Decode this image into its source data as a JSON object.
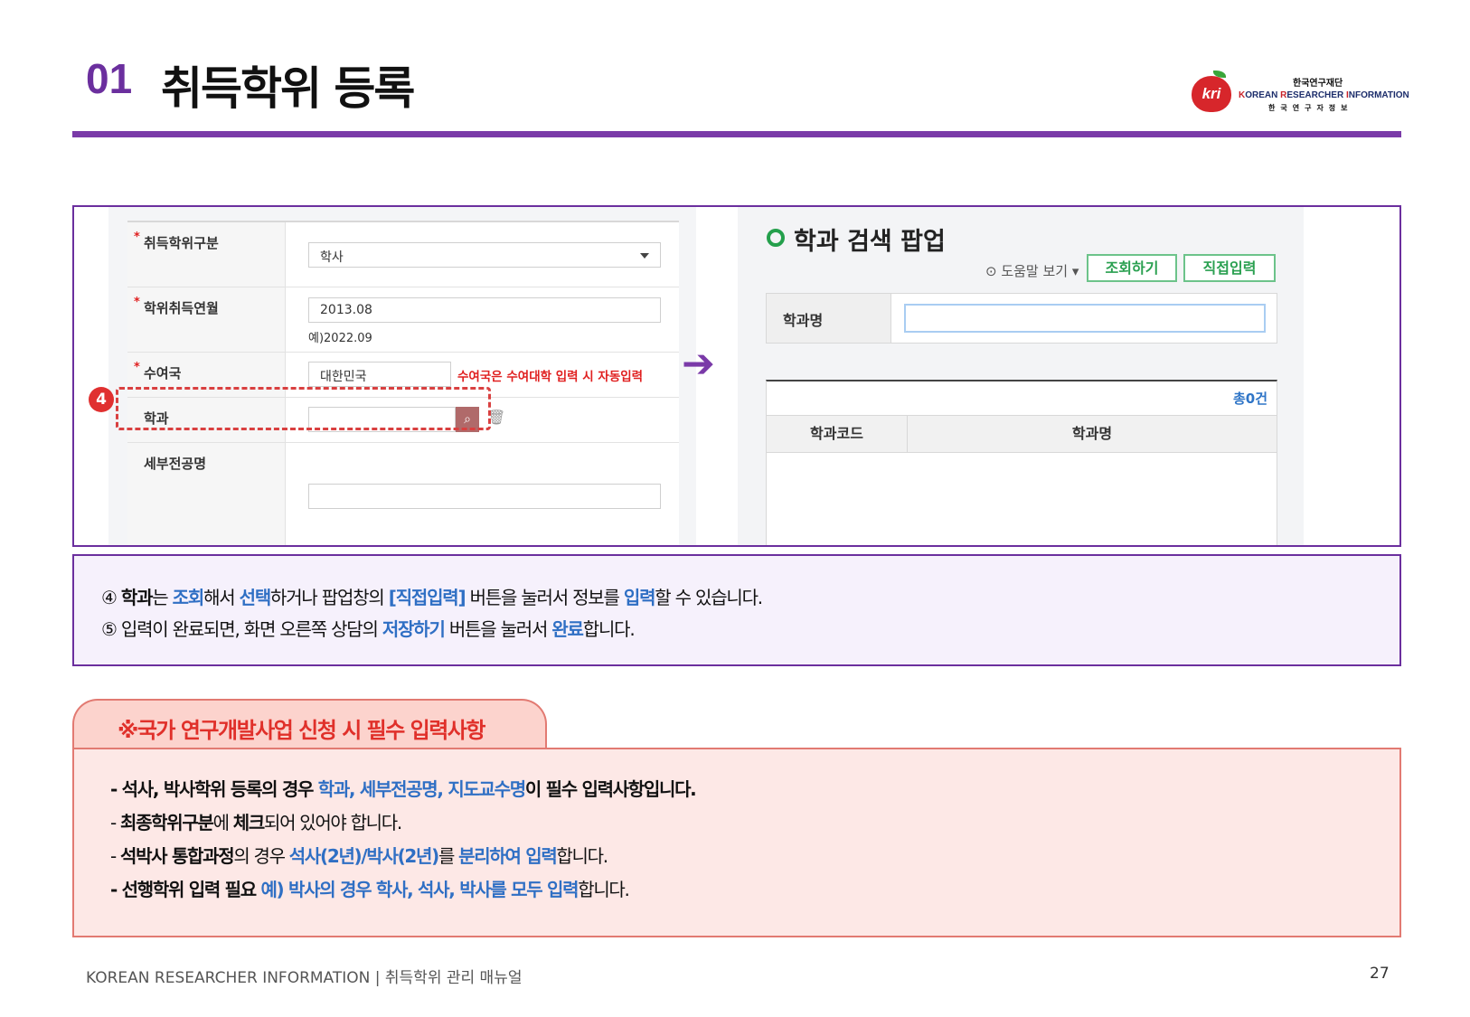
{
  "header": {
    "number": "01",
    "title": "취득학위 등록"
  },
  "logo": {
    "apple_text": "kri",
    "org_kr": "한국연구재단",
    "org_en_1": "K",
    "org_en_2": "OREAN ",
    "org_en_3": "R",
    "org_en_4": "ESEARCHER ",
    "org_en_5": "I",
    "org_en_6": "NFORMATION",
    "org_kr_spaced": "한국연구자정보"
  },
  "form": {
    "degree_type_label": "취득학위구분",
    "degree_type_value": "학사",
    "degree_date_label": "학위취득연월",
    "degree_date_value": "2013.08",
    "degree_date_example": "예)2022.09",
    "country_label": "수여국",
    "country_value": "대한민국",
    "country_note": "수여국은 수여대학 입력 시 자동입력",
    "dept_label": "학과",
    "dept_value": "",
    "major_label": "세부전공명",
    "major_value": "",
    "required_mark": "*",
    "step_badge": "4",
    "search_icon": "⌕",
    "trash_icon": "🗑"
  },
  "arrow": "➔",
  "popup": {
    "title": "학과 검색 팝업",
    "help_label": "⊙ 도움말 보기 ▾",
    "search_button": "조회하기",
    "direct_input_button": "직접입력",
    "field_label": "학과명",
    "field_value": "",
    "total": "총0건",
    "col_code": "학과코드",
    "col_name": "학과명"
  },
  "description": {
    "line1": [
      {
        "t": "④ ",
        "s": "n"
      },
      {
        "t": "학과",
        "s": "b"
      },
      {
        "t": "는 ",
        "s": "n"
      },
      {
        "t": "조회",
        "s": "blue"
      },
      {
        "t": "해서 ",
        "s": "n"
      },
      {
        "t": "선택",
        "s": "blue"
      },
      {
        "t": "하거나 팝업창의 ",
        "s": "n"
      },
      {
        "t": "[직접입력]",
        "s": "blue"
      },
      {
        "t": " 버튼을 눌러서 정보를 ",
        "s": "n"
      },
      {
        "t": "입력",
        "s": "blue"
      },
      {
        "t": "할 수 있습니다.",
        "s": "n"
      }
    ],
    "line2": [
      {
        "t": "⑤ 입력이 완료되면, 화면 오른쪽 상담의 ",
        "s": "n"
      },
      {
        "t": "저장하기",
        "s": "blue"
      },
      {
        "t": " 버튼을 눌러서 ",
        "s": "n"
      },
      {
        "t": "완료",
        "s": "blue"
      },
      {
        "t": "합니다.",
        "s": "n"
      }
    ]
  },
  "notice": {
    "title": "※국가 연구개발사업 신청 시 필수 입력사항",
    "lines": [
      [
        {
          "t": "- 석사, 박사학위 등록의 경우 ",
          "s": "b"
        },
        {
          "t": "학과, 세부전공명, 지도교수명",
          "s": "blue"
        },
        {
          "t": "이 필수 입력사항입니다.",
          "s": "b"
        }
      ],
      [
        {
          "t": "- ",
          "s": "n"
        },
        {
          "t": "최종학위구분",
          "s": "b"
        },
        {
          "t": "에 ",
          "s": "n"
        },
        {
          "t": "체크",
          "s": "b"
        },
        {
          "t": "되어 있어야 합니다.",
          "s": "n"
        }
      ],
      [
        {
          "t": "- ",
          "s": "n"
        },
        {
          "t": "석박사 통합과정",
          "s": "b"
        },
        {
          "t": "의 경우 ",
          "s": "n"
        },
        {
          "t": "석사(2년)/박사(2년)",
          "s": "blue"
        },
        {
          "t": "를 ",
          "s": "n"
        },
        {
          "t": "분리하여 입력",
          "s": "blue"
        },
        {
          "t": "합니다.",
          "s": "n"
        }
      ],
      [
        {
          "t": "- 선행학위 입력 필요 ",
          "s": "b"
        },
        {
          "t": "예) 박사의 경우 학사, 석사, 박사를 모두 입력",
          "s": "blue"
        },
        {
          "t": "합니다.",
          "s": "n"
        }
      ]
    ]
  },
  "footer": {
    "text": "KOREAN RESEARCHER INFORMATION   |  취득학위 관리 매뉴얼",
    "page": "27"
  },
  "colors": {
    "accent_purple": "#6b2f9e",
    "highlight_blue": "#2f6fc4",
    "alert_red": "#e0302a",
    "popup_green": "#2aa050"
  }
}
